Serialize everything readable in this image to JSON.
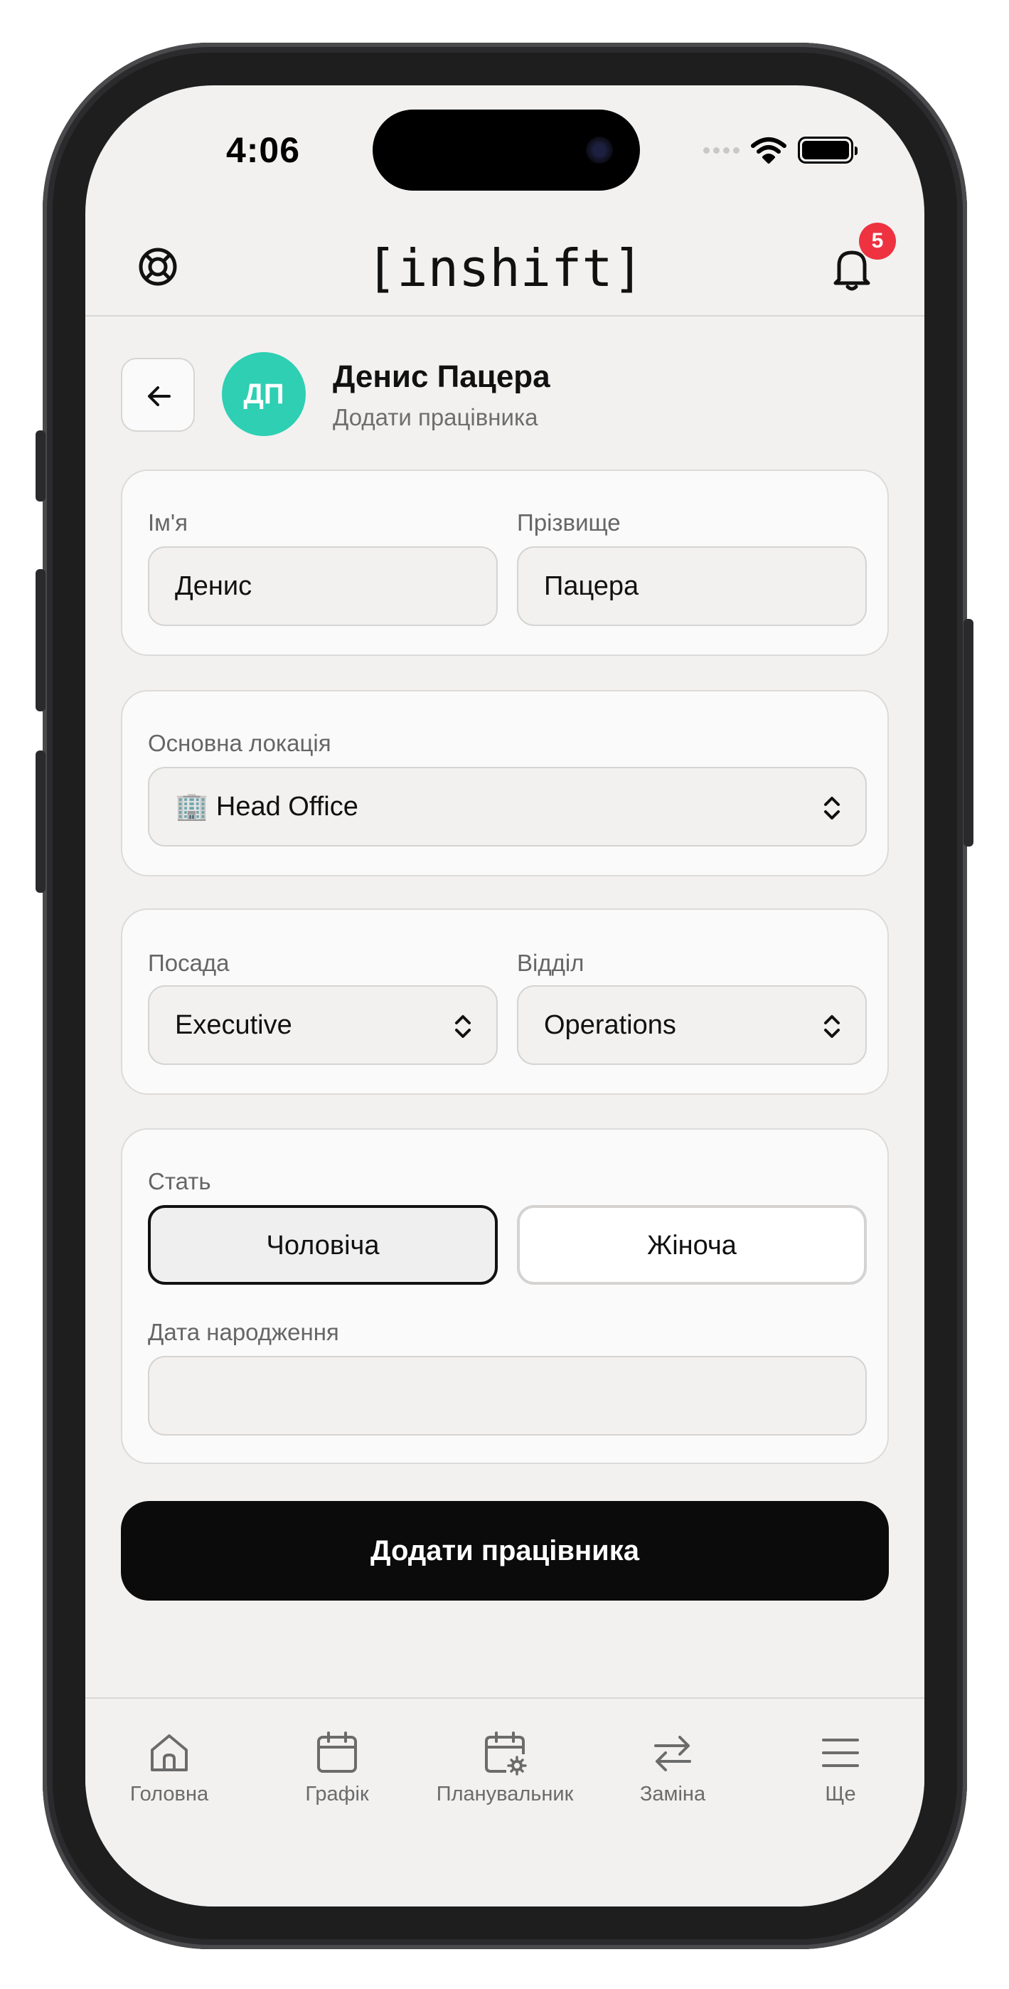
{
  "status_bar": {
    "time": "4:06"
  },
  "header": {
    "logo": "[inshift]",
    "notification_count": "5",
    "icons": {
      "left": "lifebuoy-icon",
      "right": "bell-icon"
    }
  },
  "profile": {
    "initials": "ДП",
    "name": "Денис Пацера",
    "subtitle": "Додати працівника",
    "avatar_color": "#2ecfb3"
  },
  "form": {
    "first_name": {
      "label": "Ім'я",
      "value": "Денис"
    },
    "last_name": {
      "label": "Прізвище",
      "value": "Пацера"
    },
    "location": {
      "label": "Основна локація",
      "value": "🏢 Head Office"
    },
    "position": {
      "label": "Посада",
      "value": "Executive"
    },
    "department": {
      "label": "Відділ",
      "value": "Operations"
    },
    "gender": {
      "label": "Стать",
      "options": [
        "Чоловіча",
        "Жіноча"
      ],
      "selected": "Чоловіча"
    },
    "birth_date": {
      "label": "Дата народження",
      "value": ""
    },
    "submit_label": "Додати працівника"
  },
  "tabbar": {
    "items": [
      {
        "label": "Головна",
        "icon": "home-icon"
      },
      {
        "label": "Графік",
        "icon": "calendar-icon"
      },
      {
        "label": "Планувальник",
        "icon": "calendar-gear-icon"
      },
      {
        "label": "Заміна",
        "icon": "swap-icon"
      },
      {
        "label": "Ще",
        "icon": "menu-icon"
      }
    ]
  },
  "colors": {
    "accent": "#2ecfb3",
    "badge": "#ee3240",
    "primary_button": "#0b0b0b",
    "background": "#f2f1f0"
  }
}
